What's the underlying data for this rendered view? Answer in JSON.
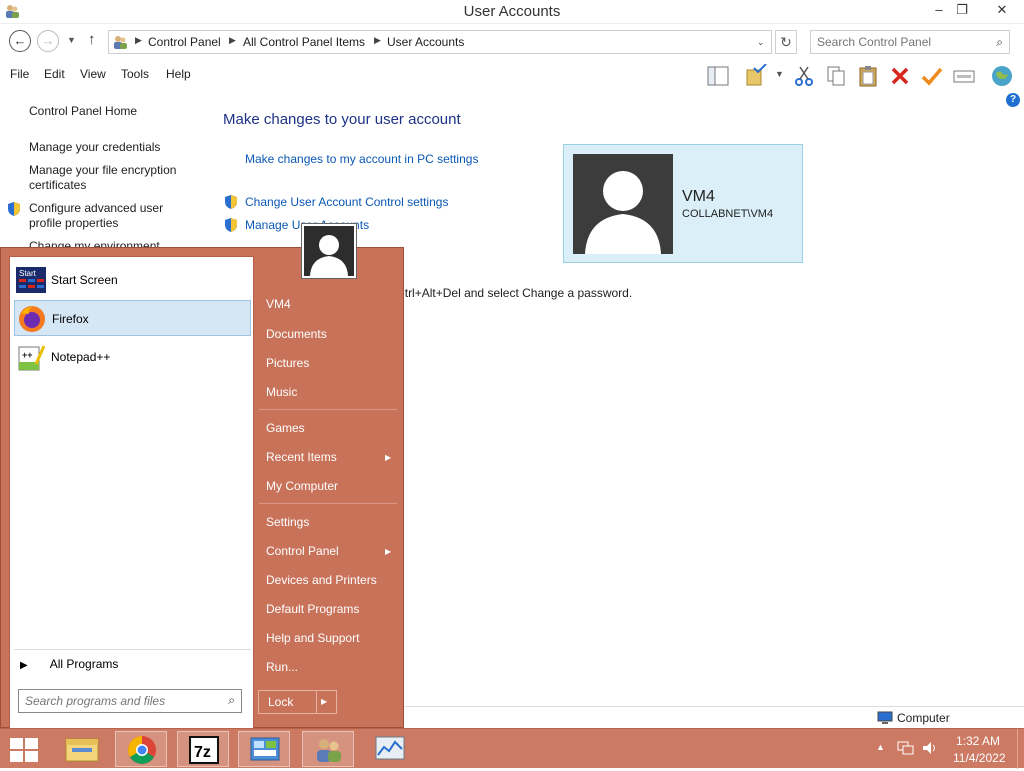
{
  "window": {
    "title": "User Accounts",
    "min_glyph": "–",
    "max_glyph": "❐",
    "close_glyph": "✕"
  },
  "address": {
    "breadcrumbs": [
      "Control Panel",
      "All Control Panel Items",
      "User Accounts"
    ],
    "search_placeholder": "Search Control Panel"
  },
  "menu": [
    "File",
    "Edit",
    "View",
    "Tools",
    "Help"
  ],
  "left_nav": {
    "home": "Control Panel Home",
    "manage_credentials": "Manage your credentials",
    "file_encryption": "Manage your file encryption certificates",
    "advanced_profile": "Configure advanced user profile properties",
    "change_env": "Change my environment"
  },
  "main": {
    "title": "Make changes to your user account",
    "pc_settings_link": "Make changes to my account in PC settings",
    "uac_link": "Change User Account Control settings",
    "manage_accounts_link": "Manage User Accounts",
    "password_note": "ge your password, press Ctrl+Alt+Del and select Change a password."
  },
  "user_card": {
    "name": "VM4",
    "domain": "COLLABNET\\VM4"
  },
  "status_bar": {
    "computer": "Computer"
  },
  "start_menu": {
    "programs": [
      {
        "label": "Start Screen",
        "icon": "start-screen-icon"
      },
      {
        "label": "Firefox",
        "icon": "firefox-icon"
      },
      {
        "label": "Notepad++",
        "icon": "notepad-plus-plus-icon"
      }
    ],
    "start_screen_badge": "Start",
    "all_programs": "All Programs",
    "search_placeholder": "Search programs and files",
    "right": {
      "user": "VM4",
      "documents": "Documents",
      "pictures": "Pictures",
      "music": "Music",
      "games": "Games",
      "recent_items": "Recent Items",
      "my_computer": "My Computer",
      "settings": "Settings",
      "control_panel": "Control Panel",
      "devices_printers": "Devices and Printers",
      "default_programs": "Default Programs",
      "help_support": "Help and Support",
      "run": "Run..."
    },
    "lock": "Lock"
  },
  "taskbar": {
    "pinned": [
      "start-button",
      "file-explorer",
      "chrome",
      "7zip",
      "control-panel",
      "user-accounts",
      "resource-monitor"
    ],
    "sevenzip_label": "7z",
    "clock_time": "1:32 AM",
    "clock_date": "11/4/2022"
  },
  "colors": {
    "start_menu_bg": "#c8725a",
    "taskbar_bg": "#cc7a63",
    "link_blue": "#0b58b5",
    "heading_blue": "#1e3287",
    "card_bg": "#daeff7"
  }
}
